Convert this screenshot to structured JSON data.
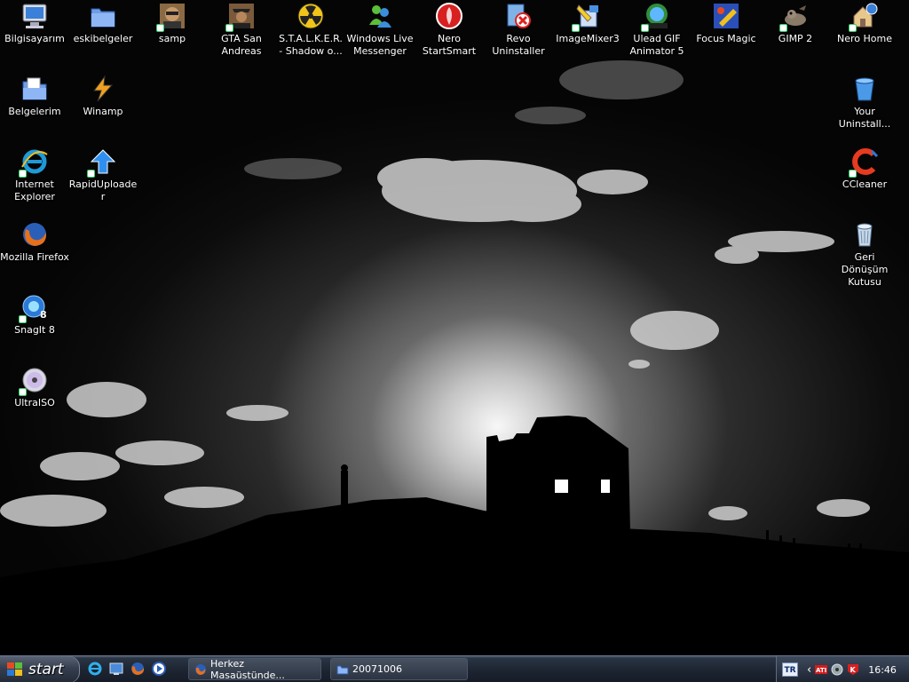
{
  "desktop": {
    "icons": [
      {
        "label": "Bilgisayarım",
        "icon": "computer-icon"
      },
      {
        "label": "eskibelgeler",
        "icon": "folder-icon"
      },
      {
        "label": "samp",
        "icon": "samp-icon"
      },
      {
        "label": "GTA San Andreas",
        "icon": "gta-icon"
      },
      {
        "label": "S.T.A.L.K.E.R. - Shadow o...",
        "icon": "radiation-icon"
      },
      {
        "label": "Windows Live Messenger",
        "icon": "messenger-icon"
      },
      {
        "label": "Nero StartSmart",
        "icon": "nero-icon"
      },
      {
        "label": "Revo Uninstaller",
        "icon": "revo-icon"
      },
      {
        "label": "ImageMixer3",
        "icon": "imagemixer-icon"
      },
      {
        "label": "Ulead GIF Animator 5",
        "icon": "ulead-icon"
      },
      {
        "label": "Focus Magic",
        "icon": "focus-magic-icon"
      },
      {
        "label": "GIMP 2",
        "icon": "gimp-icon"
      },
      {
        "label": "Nero Home",
        "icon": "nero-home-icon"
      },
      {
        "label": "Belgelerim",
        "icon": "documents-folder-icon"
      },
      {
        "label": "Winamp",
        "icon": "winamp-icon"
      },
      {
        "label": "Internet Explorer",
        "icon": "ie-icon"
      },
      {
        "label": "RapidUploader",
        "icon": "upload-arrow-icon"
      },
      {
        "label": "Mozilla Firefox",
        "icon": "firefox-icon"
      },
      {
        "label": "SnagIt 8",
        "icon": "snagit-icon"
      },
      {
        "label": "UltraISO",
        "icon": "disc-icon"
      },
      {
        "label": "Your Uninstall...",
        "icon": "trash-icon"
      },
      {
        "label": "CCleaner",
        "icon": "ccleaner-icon"
      },
      {
        "label": "Geri Dönüşüm Kutusu",
        "icon": "recycle-bin-icon"
      }
    ]
  },
  "taskbar": {
    "start_label": "start",
    "quick_launch": [
      "ie-icon",
      "show-desktop-icon",
      "firefox-icon",
      "media-player-icon"
    ],
    "tasks": [
      {
        "label": "Herkez Masaüstünde...",
        "icon": "firefox-icon"
      },
      {
        "label": "20071006",
        "icon": "folder-icon"
      }
    ],
    "tray": {
      "language": "TR",
      "clock": "16:46",
      "icons": [
        "ati-icon",
        "volume-icon",
        "kaspersky-icon"
      ]
    }
  }
}
